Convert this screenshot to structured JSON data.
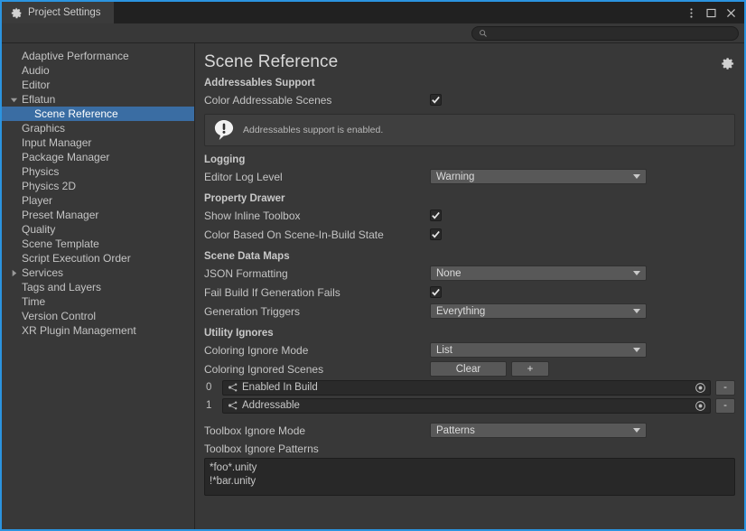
{
  "window": {
    "tab_label": "Project Settings",
    "tab_icon": "gear-icon",
    "accent_border": "#2b94e0",
    "buttons": {
      "menu": "kebab-menu-icon",
      "maximize": "maximize-icon",
      "close": "close-icon"
    }
  },
  "search": {
    "value": "",
    "placeholder": "",
    "icon": "search-icon"
  },
  "sidebar": {
    "items": [
      {
        "label": "Adaptive Performance",
        "depth": 0,
        "arrow": "none",
        "selected": false
      },
      {
        "label": "Audio",
        "depth": 0,
        "arrow": "none",
        "selected": false
      },
      {
        "label": "Editor",
        "depth": 0,
        "arrow": "none",
        "selected": false
      },
      {
        "label": "Eflatun",
        "depth": 0,
        "arrow": "expanded",
        "selected": false
      },
      {
        "label": "Scene Reference",
        "depth": 1,
        "arrow": "none",
        "selected": true
      },
      {
        "label": "Graphics",
        "depth": 0,
        "arrow": "none",
        "selected": false
      },
      {
        "label": "Input Manager",
        "depth": 0,
        "arrow": "none",
        "selected": false
      },
      {
        "label": "Package Manager",
        "depth": 0,
        "arrow": "none",
        "selected": false
      },
      {
        "label": "Physics",
        "depth": 0,
        "arrow": "none",
        "selected": false
      },
      {
        "label": "Physics 2D",
        "depth": 0,
        "arrow": "none",
        "selected": false
      },
      {
        "label": "Player",
        "depth": 0,
        "arrow": "none",
        "selected": false
      },
      {
        "label": "Preset Manager",
        "depth": 0,
        "arrow": "none",
        "selected": false
      },
      {
        "label": "Quality",
        "depth": 0,
        "arrow": "none",
        "selected": false
      },
      {
        "label": "Scene Template",
        "depth": 0,
        "arrow": "none",
        "selected": false
      },
      {
        "label": "Script Execution Order",
        "depth": 0,
        "arrow": "none",
        "selected": false
      },
      {
        "label": "Services",
        "depth": 0,
        "arrow": "collapsed",
        "selected": false
      },
      {
        "label": "Tags and Layers",
        "depth": 0,
        "arrow": "none",
        "selected": false
      },
      {
        "label": "Time",
        "depth": 0,
        "arrow": "none",
        "selected": false
      },
      {
        "label": "Version Control",
        "depth": 0,
        "arrow": "none",
        "selected": false
      },
      {
        "label": "XR Plugin Management",
        "depth": 0,
        "arrow": "none",
        "selected": false
      }
    ],
    "selection_color": "#3a6da3"
  },
  "main": {
    "title": "Scene Reference",
    "gear_icon": "gear-icon",
    "sections": {
      "addressables": {
        "head": "Addressables Support",
        "color_addressable_scenes_label": "Color Addressable Scenes",
        "color_addressable_scenes_value": true,
        "info_icon": "info-bubble-icon",
        "info_text": "Addressables support is enabled."
      },
      "logging": {
        "head": "Logging",
        "editor_log_level_label": "Editor Log Level",
        "editor_log_level_value": "Warning"
      },
      "property_drawer": {
        "head": "Property Drawer",
        "show_inline_toolbox_label": "Show Inline Toolbox",
        "show_inline_toolbox_value": true,
        "color_based_on_state_label": "Color Based On Scene-In-Build State",
        "color_based_on_state_value": true
      },
      "scene_data_maps": {
        "head": "Scene Data Maps",
        "json_formatting_label": "JSON Formatting",
        "json_formatting_value": "None",
        "fail_build_label": "Fail Build If Generation Fails",
        "fail_build_value": true,
        "generation_triggers_label": "Generation Triggers",
        "generation_triggers_value": "Everything"
      },
      "utility_ignores": {
        "head": "Utility Ignores",
        "coloring_ignore_mode_label": "Coloring Ignore Mode",
        "coloring_ignore_mode_value": "List",
        "coloring_ignored_scenes_label": "Coloring Ignored Scenes",
        "clear_button": "Clear",
        "add_button": "+",
        "remove_button": "-",
        "list": [
          {
            "index": "0",
            "icon": "unity-scene-icon",
            "name": "Enabled In Build",
            "picker": "object-picker-icon"
          },
          {
            "index": "1",
            "icon": "unity-scene-icon",
            "name": "Addressable",
            "picker": "object-picker-icon"
          }
        ],
        "toolbox_ignore_mode_label": "Toolbox Ignore Mode",
        "toolbox_ignore_mode_value": "Patterns",
        "toolbox_ignore_patterns_label": "Toolbox Ignore Patterns",
        "toolbox_ignore_patterns_value": "*foo*.unity\n!*bar.unity"
      }
    }
  }
}
